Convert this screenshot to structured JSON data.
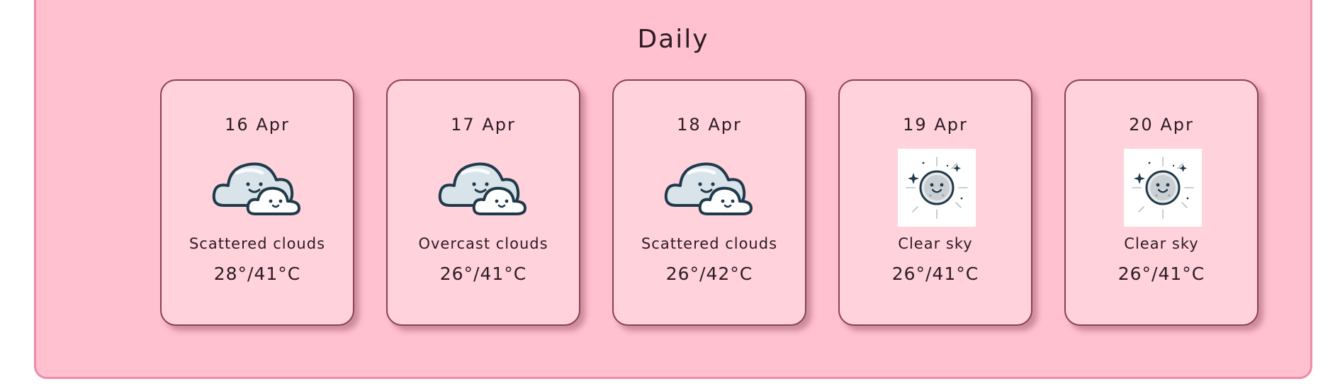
{
  "section": {
    "title": "Daily"
  },
  "colors": {
    "panel_bg": "#ffc0cf",
    "panel_border": "#f28aa6",
    "card_bg": "#ffd2dc",
    "card_border": "#8a4058",
    "text": "#2c1c24"
  },
  "days": [
    {
      "date": "16 Apr",
      "icon": "cloudy-icon",
      "description": "Scattered clouds",
      "temp": "28°/41°C"
    },
    {
      "date": "17 Apr",
      "icon": "cloudy-icon",
      "description": "Overcast clouds",
      "temp": "26°/41°C"
    },
    {
      "date": "18 Apr",
      "icon": "cloudy-icon",
      "description": "Scattered clouds",
      "temp": "26°/42°C"
    },
    {
      "date": "19 Apr",
      "icon": "clear-sky-icon",
      "description": "Clear sky",
      "temp": "26°/41°C"
    },
    {
      "date": "20 Apr",
      "icon": "clear-sky-icon",
      "description": "Clear sky",
      "temp": "26°/41°C"
    }
  ]
}
